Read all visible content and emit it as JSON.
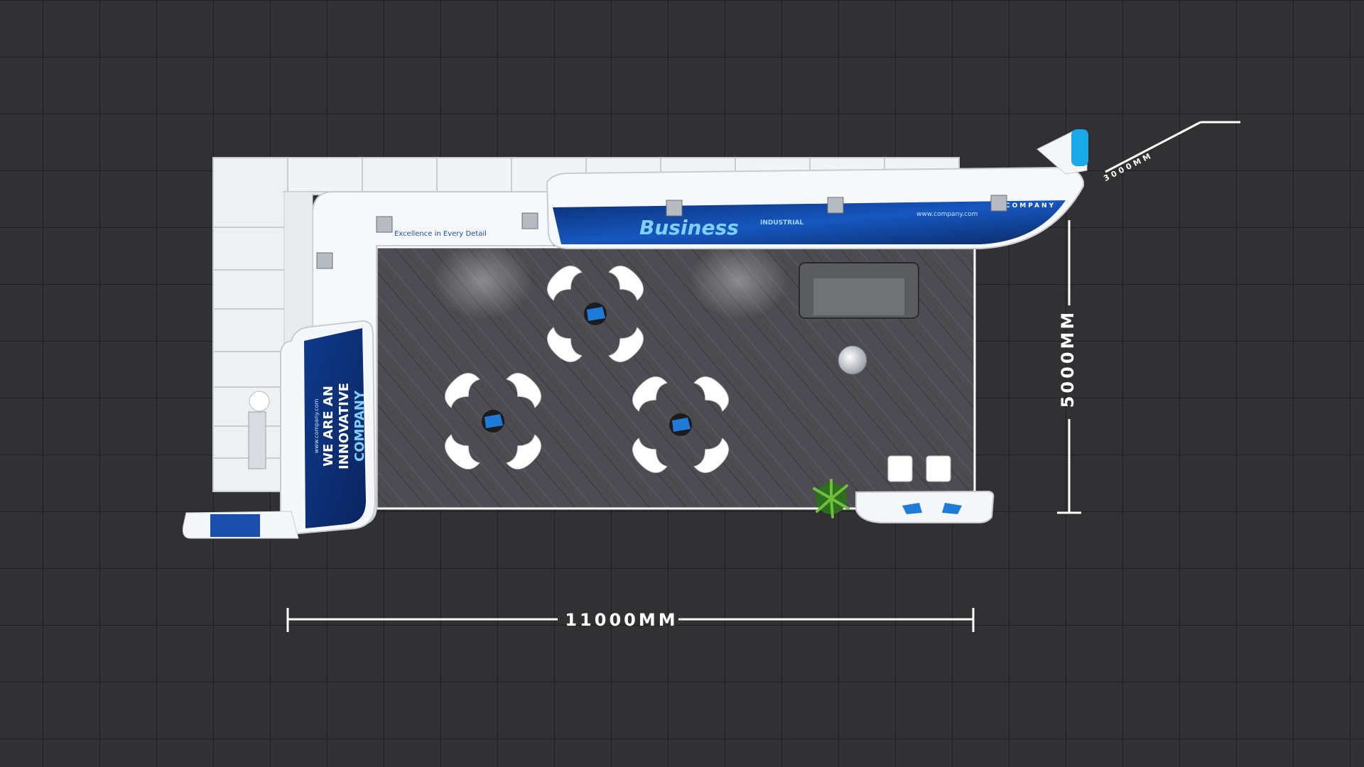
{
  "dimensions": {
    "width_label": "11000MM",
    "depth_label": "5000MM",
    "diagonal_label": "3000MM"
  },
  "graphics": {
    "main_header_headline": "Business",
    "main_header_subtitle": "INDUSTRIAL",
    "main_header_url": "www.company.com",
    "main_header_brand": "COMPANY",
    "small_header_tagline": "Excellence in Every Detail",
    "side_panel_line1": "WE ARE AN",
    "side_panel_line2": "INNOVATIVE",
    "side_panel_line3": "COMPANY",
    "side_panel_url": "www.company.com"
  },
  "colors": {
    "background": "#2e2e30",
    "grid_line": "#3a3a3c",
    "wall_white": "#f4f6f8",
    "brand_blue": "#1a4fae",
    "brand_cyan": "#19a8e8",
    "floor": "#4a4a50",
    "dimension_line": "#ffffff"
  }
}
